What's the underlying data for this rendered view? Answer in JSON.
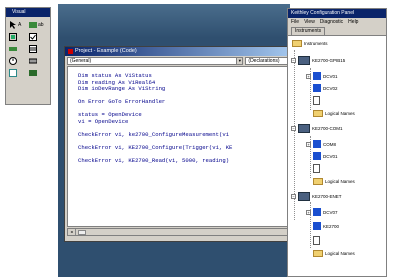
{
  "toolbox": {
    "title": "Visual",
    "items": [
      {
        "icon": "pointer-icon",
        "label": "A"
      },
      {
        "icon": "label-icon",
        "label": "ab"
      },
      {
        "icon": "frame-icon",
        "label": ""
      },
      {
        "icon": "checkbox-icon",
        "label": ""
      },
      {
        "icon": "combobox-icon",
        "label": ""
      },
      {
        "icon": "listbox-icon",
        "label": ""
      },
      {
        "icon": "timer-icon",
        "label": ""
      },
      {
        "icon": "drive-icon",
        "label": ""
      },
      {
        "icon": "image-icon",
        "label": ""
      },
      {
        "icon": "data-icon",
        "label": ""
      }
    ]
  },
  "code_window": {
    "title": "Project - Example (Code)",
    "object_combo": "(General)",
    "proc_combo": "(Declarations)",
    "lines": [
      "Dim status As ViStatus",
      "Dim reading As ViReal64",
      "Dim ioDevRange As ViString",
      "",
      "On Error GoTo ErrorHandler",
      "",
      "status = OpenDevice",
      "vi = OpenDevice",
      "",
      "CheckError vi, ke2700_ConfigureMeasurement(vi",
      "",
      "CheckError vi, KE2700_Configure(Trigger(vi, KE",
      "",
      "CheckError vi, KE2700_Read(vi, 5000, reading)"
    ]
  },
  "explorer": {
    "title": "Keithley Configuration Panel",
    "menu": [
      "File",
      "View",
      "Diagnostic",
      "Help"
    ],
    "tab": "Instruments",
    "tree": {
      "root": "Instruments",
      "groups": [
        {
          "name": "KE2700-GPIB15",
          "children": [
            {
              "icon": "dev",
              "label": "DCV01"
            },
            {
              "icon": "dev",
              "label": "DCV02"
            },
            {
              "icon": "res",
              "label": ""
            },
            {
              "icon": "folder",
              "label": "Logical Names"
            }
          ]
        },
        {
          "name": "KE2700-COM1",
          "children": [
            {
              "icon": "dev",
              "label": "COM8"
            },
            {
              "icon": "dev",
              "label": "DCV01"
            },
            {
              "icon": "res",
              "label": ""
            },
            {
              "icon": "folder",
              "label": "Logical Names"
            }
          ]
        },
        {
          "name": "KE2700-ENET",
          "children": [
            {
              "icon": "dev",
              "label": "DCV07"
            },
            {
              "icon": "dev",
              "label": "KE2700"
            },
            {
              "icon": "res",
              "label": ""
            },
            {
              "icon": "folder",
              "label": "Logical Names"
            }
          ]
        }
      ]
    }
  }
}
